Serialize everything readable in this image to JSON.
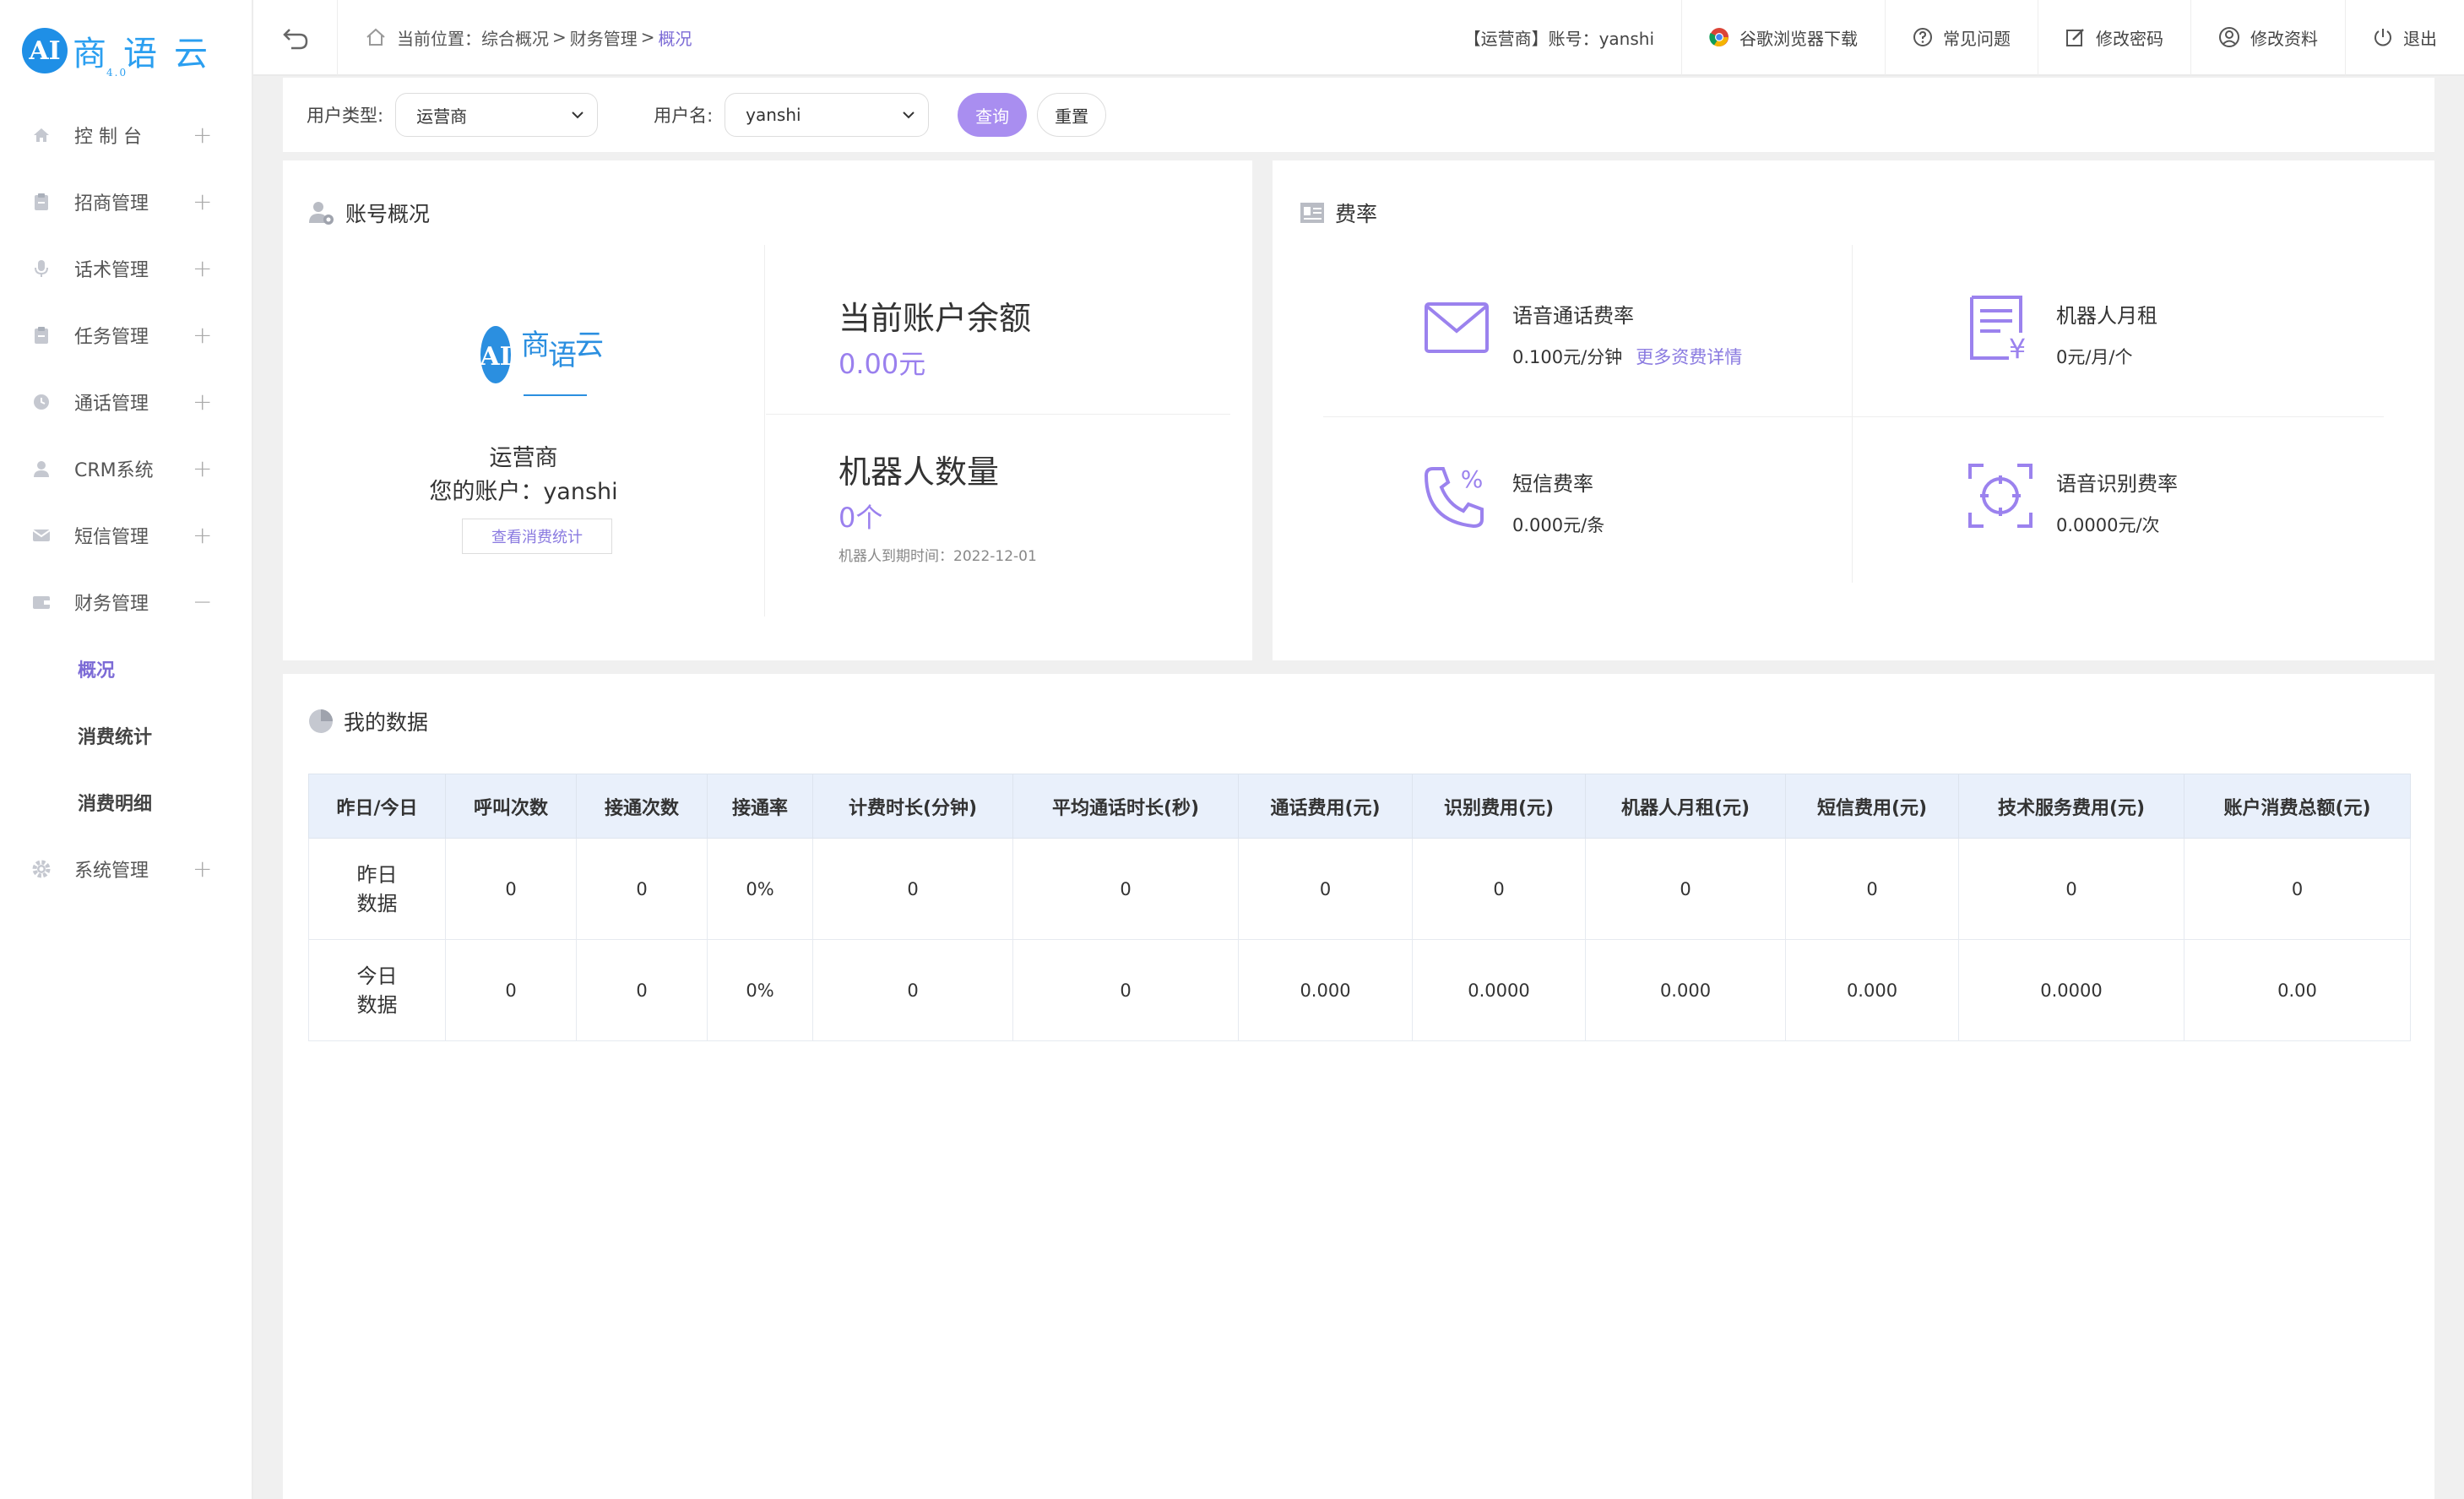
{
  "brand": {
    "badge": "AI",
    "name": "商语云",
    "version": "4.0"
  },
  "sidebar": {
    "items": [
      {
        "label": "控 制 台",
        "icon": "home-icon",
        "toggle": "+"
      },
      {
        "label": "招商管理",
        "icon": "clipboard-icon",
        "toggle": "+"
      },
      {
        "label": "话术管理",
        "icon": "microphone-icon",
        "toggle": "+"
      },
      {
        "label": "任务管理",
        "icon": "clipboard-icon",
        "toggle": "+"
      },
      {
        "label": "通话管理",
        "icon": "clock-icon",
        "toggle": "+"
      },
      {
        "label": "CRM系统",
        "icon": "user-icon",
        "toggle": "+"
      },
      {
        "label": "短信管理",
        "icon": "mail-icon",
        "toggle": "+"
      },
      {
        "label": "财务管理",
        "icon": "wallet-icon",
        "toggle": "−"
      },
      {
        "label": "系统管理",
        "icon": "gear-icon",
        "toggle": "+"
      }
    ],
    "finance_sub": [
      {
        "label": "概况",
        "active": true
      },
      {
        "label": "消费统计",
        "active": false
      },
      {
        "label": "消费明细",
        "active": false
      }
    ]
  },
  "header": {
    "crumb_prefix": "当前位置：综合概况",
    "crumb_sep": ">",
    "crumb_mid": "财务管理",
    "crumb_current": "概况",
    "account": "【运营商】账号：yanshi",
    "chrome": "谷歌浏览器下载",
    "faq": "常见问题",
    "change_password": "修改密码",
    "edit_profile": "修改资料",
    "logout": "退出"
  },
  "filter": {
    "user_type_label": "用户类型:",
    "user_type_value": "运营商",
    "username_label": "用户名:",
    "username_value": "yanshi",
    "query": "查询",
    "reset": "重置"
  },
  "account": {
    "title": "账号概况",
    "role": "运营商",
    "account_line": "您的账户：yanshi",
    "stat_btn": "查看消费统计",
    "balance_label": "当前账户余额",
    "balance_value": "0.00元",
    "robot_label": "机器人数量",
    "robot_value": "0个",
    "robot_expire": "机器人到期时间：2022-12-01"
  },
  "rates": {
    "title": "费率",
    "voice_name": "语音通话费率",
    "voice_value": "0.100元/分钟",
    "voice_link": "更多资费详情",
    "robot_name": "机器人月租",
    "robot_value": "0元/月/个",
    "sms_name": "短信费率",
    "sms_value": "0.000元/条",
    "asr_name": "语音识别费率",
    "asr_value": "0.0000元/次"
  },
  "data": {
    "title": "我的数据",
    "columns": [
      "昨日/今日",
      "呼叫次数",
      "接通次数",
      "接通率",
      "计费时长(分钟)",
      "平均通话时长(秒)",
      "通话费用(元)",
      "识别费用(元)",
      "机器人月租(元)",
      "短信费用(元)",
      "技术服务费用(元)",
      "账户消费总额(元)"
    ],
    "rows": [
      {
        "head1": "昨日",
        "head2": "数据",
        "cells": [
          "0",
          "0",
          "0%",
          "0",
          "0",
          "0",
          "0",
          "0",
          "0",
          "0",
          "0"
        ]
      },
      {
        "head1": "今日",
        "head2": "数据",
        "cells": [
          "0",
          "0",
          "0%",
          "0",
          "0",
          "0.000",
          "0.0000",
          "0.000",
          "0.000",
          "0.0000",
          "0.00"
        ]
      }
    ]
  }
}
